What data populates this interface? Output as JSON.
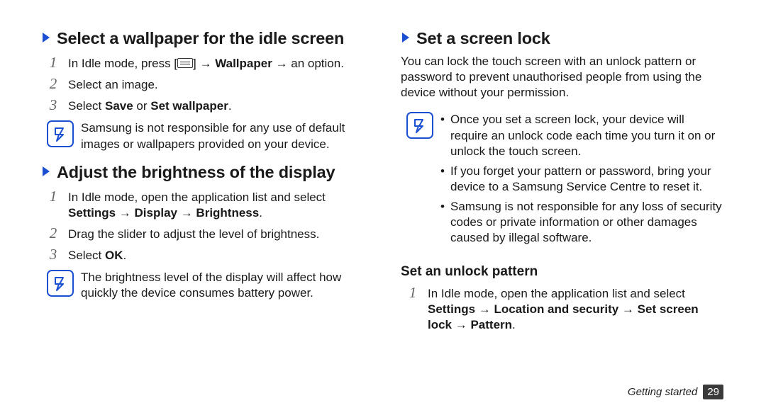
{
  "left": {
    "section1": {
      "title": "Select a wallpaper for the idle screen",
      "step1_pre": "In Idle mode, press [",
      "step1_mid": "] → ",
      "step1_bold": "Wallpaper",
      "step1_post": " → an option.",
      "step2": "Select an image.",
      "step3_pre": "Select ",
      "step3_bold1": "Save",
      "step3_mid": " or ",
      "step3_bold2": "Set wallpaper",
      "step3_post": ".",
      "note": "Samsung is not responsible for any use of default images or wallpapers provided on your device."
    },
    "section2": {
      "title": "Adjust the brightness of the display",
      "step1_pre": "In Idle mode, open the application list and select ",
      "step1_bold": "Settings → Display → Brightness",
      "step1_post": ".",
      "step2": "Drag the slider to adjust the level of brightness.",
      "step3_pre": "Select ",
      "step3_bold": "OK",
      "step3_post": ".",
      "note": "The brightness level of the display will affect how quickly the device consumes battery power."
    }
  },
  "right": {
    "section1": {
      "title": "Set a screen lock",
      "intro": "You can lock the touch screen with an unlock pattern or password to prevent unauthorised people from using the device without your permission.",
      "bullet1": "Once you set a screen lock, your device will require an unlock code each time you turn it on or unlock the touch screen.",
      "bullet2": "If you forget your pattern or password, bring your device to a Samsung Service Centre to reset it.",
      "bullet3": "Samsung is not responsible for any loss of security codes or private information or other damages caused by illegal software."
    },
    "sub": {
      "title": "Set an unlock pattern",
      "step1_pre": "In Idle mode, open the application list and select ",
      "step1_bold": "Settings → Location and security → Set screen lock → Pattern",
      "step1_post": "."
    }
  },
  "footer": {
    "label": "Getting started",
    "page": "29"
  }
}
